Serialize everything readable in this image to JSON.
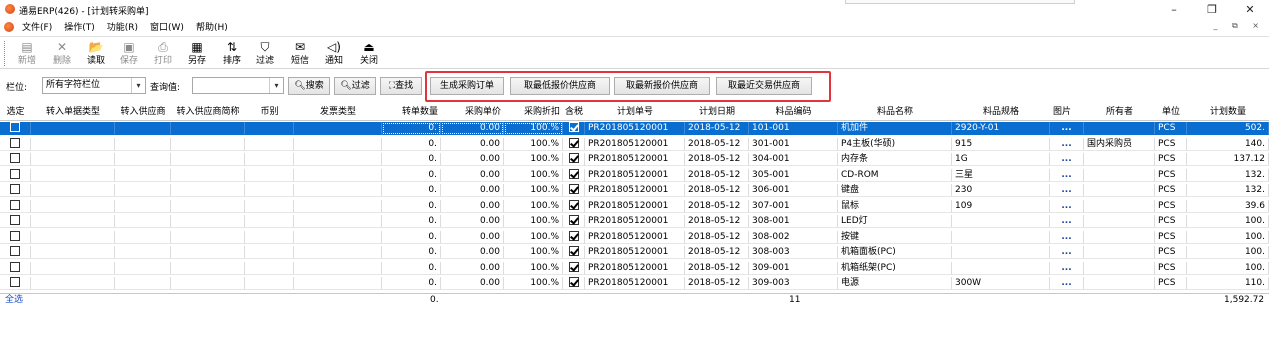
{
  "window": {
    "title": "通易ERP(426) - [计划转采购单]",
    "controls": [
      "–",
      "❐",
      "✕"
    ],
    "mdi_controls": "_ ⧉ ×"
  },
  "menu": {
    "items": [
      "文件(F)",
      "操作(T)",
      "功能(R)",
      "窗口(W)",
      "帮助(H)"
    ]
  },
  "toolbar": {
    "buttons": [
      {
        "label": "新增",
        "icon": "new-icon",
        "glyph": "▤",
        "enabled": false
      },
      {
        "label": "删除",
        "icon": "delete-icon",
        "glyph": "✕",
        "enabled": false
      },
      {
        "label": "读取",
        "icon": "open-folder-icon",
        "glyph": "📂",
        "enabled": true
      },
      {
        "label": "保存",
        "icon": "save-icon",
        "glyph": "▣",
        "enabled": false
      },
      {
        "label": "打印",
        "icon": "print-icon",
        "glyph": "⎙",
        "enabled": false
      },
      {
        "label": "另存",
        "icon": "save-as-icon",
        "glyph": "▦",
        "enabled": true
      },
      {
        "label": "排序",
        "icon": "sort-icon",
        "glyph": "⇅",
        "enabled": true
      },
      {
        "label": "过滤",
        "icon": "filter-icon",
        "glyph": "⛉",
        "enabled": true
      },
      {
        "label": "短信",
        "icon": "sms-icon",
        "glyph": "✉",
        "enabled": true
      },
      {
        "label": "通知",
        "icon": "notify-icon",
        "glyph": "◁)",
        "enabled": true
      },
      {
        "label": "关闭",
        "icon": "exit-icon",
        "glyph": "⏏",
        "enabled": true
      }
    ]
  },
  "filter": {
    "field_label": "栏位:",
    "field_value": "所有字符栏位",
    "query_label": "查询值:",
    "query_value": "",
    "search_button": "搜索",
    "filter_button": "过滤",
    "find_button": "查找",
    "action_buttons": [
      "生成采购订单",
      "取最低报价供应商",
      "取最新报价供应商",
      "取最近交易供应商"
    ],
    "highlight_color": "#e2343c"
  },
  "grid": {
    "columns": [
      "选定",
      "转入单据类型",
      "转入供应商",
      "转入供应商简称",
      "币别",
      "发票类型",
      "转单数量",
      "采购单价",
      "采购折扣",
      "含税",
      "计划单号",
      "计划日期",
      "料品编码",
      "料品名称",
      "料品规格",
      "图片",
      "所有者",
      "单位",
      "计划数量"
    ],
    "selected_row_color": "#0a6ed1",
    "rows": [
      {
        "qty": "0.",
        "price": "0.00",
        "discount": "100.%",
        "tax": true,
        "plan_no": "PR201805120001",
        "date": "2018-05-12",
        "code": "101-001",
        "name": "机加件",
        "spec": "2920-Y-01",
        "pic": "...",
        "owner": "",
        "unit": "PCS",
        "plan_qty": "502."
      },
      {
        "qty": "0.",
        "price": "0.00",
        "discount": "100.%",
        "tax": true,
        "plan_no": "PR201805120001",
        "date": "2018-05-12",
        "code": "301-001",
        "name": "P4主板(华硕)",
        "spec": "915",
        "pic": "...",
        "owner": "国内采购员",
        "unit": "PCS",
        "plan_qty": "140."
      },
      {
        "qty": "0.",
        "price": "0.00",
        "discount": "100.%",
        "tax": true,
        "plan_no": "PR201805120001",
        "date": "2018-05-12",
        "code": "304-001",
        "name": "内存条",
        "spec": "1G",
        "pic": "...",
        "owner": "",
        "unit": "PCS",
        "plan_qty": "137.12"
      },
      {
        "qty": "0.",
        "price": "0.00",
        "discount": "100.%",
        "tax": true,
        "plan_no": "PR201805120001",
        "date": "2018-05-12",
        "code": "305-001",
        "name": "CD-ROM",
        "spec": "三星",
        "pic": "...",
        "owner": "",
        "unit": "PCS",
        "plan_qty": "132."
      },
      {
        "qty": "0.",
        "price": "0.00",
        "discount": "100.%",
        "tax": true,
        "plan_no": "PR201805120001",
        "date": "2018-05-12",
        "code": "306-001",
        "name": "键盘",
        "spec": "230",
        "pic": "...",
        "owner": "",
        "unit": "PCS",
        "plan_qty": "132."
      },
      {
        "qty": "0.",
        "price": "0.00",
        "discount": "100.%",
        "tax": true,
        "plan_no": "PR201805120001",
        "date": "2018-05-12",
        "code": "307-001",
        "name": "鼠标",
        "spec": "109",
        "pic": "...",
        "owner": "",
        "unit": "PCS",
        "plan_qty": "39.6"
      },
      {
        "qty": "0.",
        "price": "0.00",
        "discount": "100.%",
        "tax": true,
        "plan_no": "PR201805120001",
        "date": "2018-05-12",
        "code": "308-001",
        "name": "LED灯",
        "spec": "",
        "pic": "...",
        "owner": "",
        "unit": "PCS",
        "plan_qty": "100."
      },
      {
        "qty": "0.",
        "price": "0.00",
        "discount": "100.%",
        "tax": true,
        "plan_no": "PR201805120001",
        "date": "2018-05-12",
        "code": "308-002",
        "name": "按键",
        "spec": "",
        "pic": "...",
        "owner": "",
        "unit": "PCS",
        "plan_qty": "100."
      },
      {
        "qty": "0.",
        "price": "0.00",
        "discount": "100.%",
        "tax": true,
        "plan_no": "PR201805120001",
        "date": "2018-05-12",
        "code": "308-003",
        "name": "机箱面板(PC)",
        "spec": "",
        "pic": "...",
        "owner": "",
        "unit": "PCS",
        "plan_qty": "100."
      },
      {
        "qty": "0.",
        "price": "0.00",
        "discount": "100.%",
        "tax": true,
        "plan_no": "PR201805120001",
        "date": "2018-05-12",
        "code": "309-001",
        "name": "机箱纸架(PC)",
        "spec": "",
        "pic": "...",
        "owner": "",
        "unit": "PCS",
        "plan_qty": "100."
      },
      {
        "qty": "0.",
        "price": "0.00",
        "discount": "100.%",
        "tax": true,
        "plan_no": "PR201805120001",
        "date": "2018-05-12",
        "code": "309-003",
        "name": "电源",
        "spec": "300W",
        "pic": "...",
        "owner": "",
        "unit": "PCS",
        "plan_qty": "110."
      }
    ],
    "footer": {
      "select_all": "全选",
      "qty_total": "0.",
      "row_count": "11",
      "plan_qty_total": "1,592.72"
    }
  }
}
